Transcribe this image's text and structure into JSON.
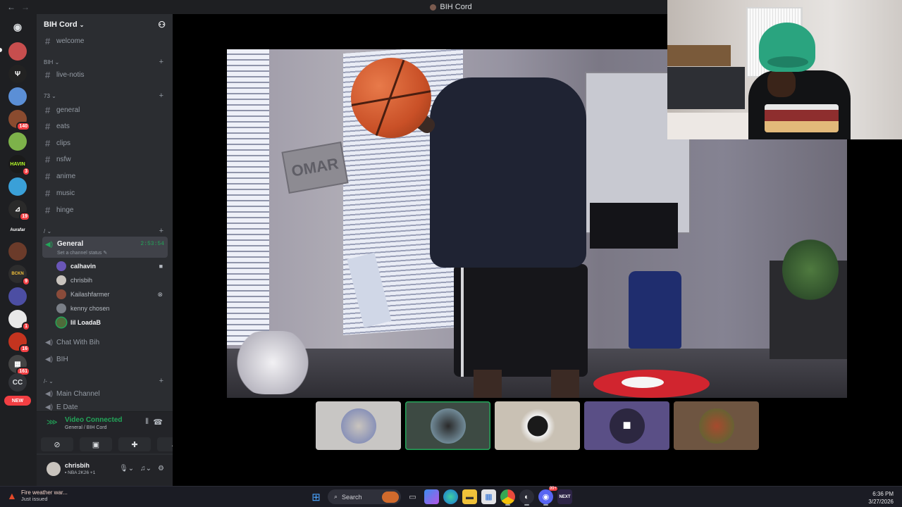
{
  "window": {
    "title": "BIH Cord",
    "back_icon": "arrow-left-icon",
    "forward_icon": "arrow-right-icon"
  },
  "servers": {
    "home_icon": "discord-icon",
    "items": [
      {
        "badge": ""
      },
      {
        "badge": ""
      },
      {
        "badge": ""
      },
      {
        "badge": "140"
      },
      {
        "badge": ""
      },
      {
        "badge": "3"
      },
      {
        "badge": ""
      },
      {
        "badge": "19"
      },
      {
        "badge": ""
      },
      {
        "badge": ""
      },
      {
        "badge": "9"
      },
      {
        "badge": ""
      },
      {
        "badge": "1"
      },
      {
        "badge": "16"
      },
      {
        "badge": "161"
      }
    ],
    "cc_label": "CC",
    "new_label": "NEW"
  },
  "sidebar": {
    "guild_name": "BIH Cord",
    "welcome": "welcome",
    "cat_bih": "BIH",
    "live_notis": "live-notis",
    "cat_73": "73",
    "channels": [
      "general",
      "eats",
      "clips",
      "nsfw",
      "anime",
      "music",
      "hinge"
    ],
    "cat_slash": "/",
    "voice_general": {
      "name": "General",
      "timer": "2:53:54",
      "status": "Set a channel status"
    },
    "voice_users": [
      "calhavin",
      "chrisbih",
      "Kailashfarmer",
      "kenny chosen",
      "lil LoadaB"
    ],
    "chat_with_bih": "Chat With Bih",
    "bih_voice": "BIH",
    "cat_tilde": "/-",
    "main_channel": "Main Channel",
    "partial": "E Date"
  },
  "vc_panel": {
    "status": "Video Connected",
    "sub": "General / BIH Cord"
  },
  "user": {
    "name": "chrisbih",
    "status": "NBA 2K26 +1"
  },
  "taskbar": {
    "weather_title": "Fire weather war...",
    "weather_sub": "Just issued",
    "search_label": "Search",
    "time": "6:36 PM",
    "date": "3/27/2026",
    "discord_badge": "99+",
    "next_label": "NEXT"
  },
  "video": {
    "sign_text": "OMAR"
  },
  "colors": {
    "accent_green": "#23a559",
    "sidebar_bg": "#2b2d31",
    "rail_bg": "#1e1f22"
  }
}
